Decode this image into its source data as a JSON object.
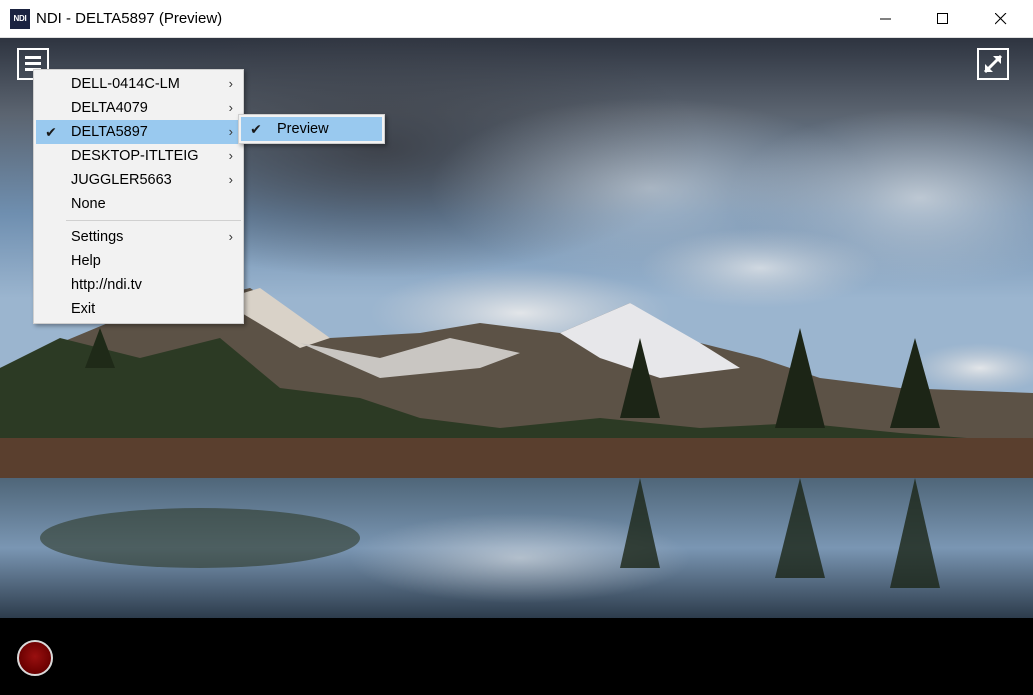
{
  "window": {
    "title": "NDI - DELTA5897 (Preview)",
    "logo_text": "NDI",
    "controls": [
      "minimize",
      "maximize",
      "close"
    ]
  },
  "overlay": {
    "menu_icon": "hamburger-menu-icon",
    "fullscreen_icon": "expand-arrows-icon",
    "record_icon": "record-icon",
    "record_color": "#7a0000"
  },
  "menu": {
    "sources": [
      {
        "label": "DELL-0414C-LM",
        "has_submenu": true,
        "checked": false
      },
      {
        "label": "DELTA4079",
        "has_submenu": true,
        "checked": false
      },
      {
        "label": "DELTA5897",
        "has_submenu": true,
        "checked": true,
        "highlighted": true
      },
      {
        "label": "DESKTOP-ITLTEIG",
        "has_submenu": true,
        "checked": false
      },
      {
        "label": "JUGGLER5663",
        "has_submenu": true,
        "checked": false
      },
      {
        "label": "None",
        "has_submenu": false,
        "checked": false
      }
    ],
    "actions": [
      {
        "label": "Settings",
        "has_submenu": true
      },
      {
        "label": "Help",
        "has_submenu": false
      },
      {
        "label": "http://ndi.tv",
        "has_submenu": false
      },
      {
        "label": "Exit",
        "has_submenu": false
      }
    ],
    "highlight_color": "#99c9ef"
  },
  "submenu": {
    "items": [
      {
        "label": "Preview",
        "checked": true,
        "highlighted": true
      }
    ]
  }
}
